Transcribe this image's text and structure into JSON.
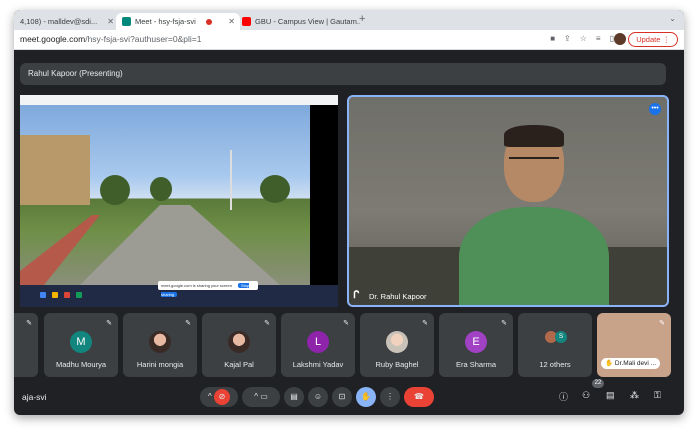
{
  "tabs": [
    {
      "title": "4,108) - malldev@sdi...",
      "active": false
    },
    {
      "title": "Meet - hsy-fsja-svi",
      "active": true
    },
    {
      "title": "GBU - Campus View | Gautam...",
      "active": false
    }
  ],
  "address": {
    "url_main": "meet.google.com",
    "url_rest": "/hsy-fsja-svi?authuser=0&pli=1",
    "update_label": "Update"
  },
  "meet": {
    "presenting_label": "Rahul Kapoor (Presenting)",
    "speaker_name": "Dr. Rahul Kapoor",
    "share_notice": "meet.google.com is sharing your screen",
    "share_stop": "Stop sharing",
    "meeting_code": "aja-svi",
    "participant_count": "22"
  },
  "participants": [
    {
      "name": "Madhu Mourya",
      "initial": "M",
      "color": "#12867e"
    },
    {
      "name": "Harini mongia",
      "initial": "",
      "color": ""
    },
    {
      "name": "Kajal Pal",
      "initial": "",
      "color": ""
    },
    {
      "name": "Lakshmi Yadav",
      "initial": "L",
      "color": "#8e24aa"
    },
    {
      "name": "Ruby Baghel",
      "initial": "",
      "color": ""
    },
    {
      "name": "Era Sharma",
      "initial": "E",
      "color": "#a142c4"
    }
  ],
  "others_label": "12 others",
  "self_label": "Dr.Mali devi ...",
  "colors": {
    "accent": "#8ab4f8",
    "end_call": "#ea4335",
    "background": "#202124",
    "tile": "#3c4043"
  }
}
